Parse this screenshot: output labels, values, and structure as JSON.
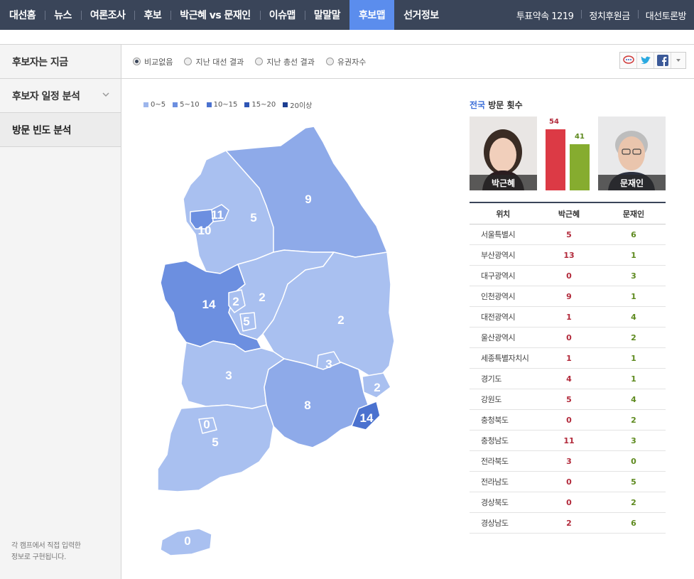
{
  "nav": {
    "left": [
      "대선홈",
      "뉴스",
      "여론조사",
      "후보",
      "박근혜 vs 문재인",
      "이슈맵",
      "말말말",
      "후보맵",
      "선거정보"
    ],
    "active_index": 7,
    "right": [
      "투표약속 1219",
      "정치후원금",
      "대선토론방"
    ]
  },
  "sidebar": {
    "items": [
      "후보자는 지금",
      "후보자 일정 분석",
      "방문 빈도 분석"
    ],
    "note_line1": "각 캠프에서 직접 입력한",
    "note_line2": "정보로 구현됩니다."
  },
  "filters": [
    "비교없음",
    "지난 대선 결과",
    "지난 총선 결과",
    "유권자수"
  ],
  "legend": [
    {
      "label": "0~5",
      "color": "#9db6ec"
    },
    {
      "label": "5~10",
      "color": "#6c8fe0"
    },
    {
      "label": "10~15",
      "color": "#4b72cf"
    },
    {
      "label": "15~20",
      "color": "#2f56b5"
    },
    {
      "label": "20이상",
      "color": "#1d3f92"
    }
  ],
  "map_labels": [
    "9",
    "11",
    "10",
    "5",
    "14",
    "2",
    "2",
    "5",
    "2",
    "3",
    "3",
    "8",
    "2",
    "14",
    "0",
    "5",
    "0"
  ],
  "panel": {
    "title_region": "전국",
    "title_rest": " 방문 횟수",
    "park": {
      "name": "박근혜",
      "total": "54",
      "value": 54,
      "color": "#dc3a45"
    },
    "moon": {
      "name": "문재인",
      "total": "41",
      "value": 41,
      "color": "#86ac2f"
    }
  },
  "table": {
    "headers": [
      "위치",
      "박근혜",
      "문재인"
    ],
    "rows": [
      [
        "서울특별시",
        "5",
        "6"
      ],
      [
        "부산광역시",
        "13",
        "1"
      ],
      [
        "대구광역시",
        "0",
        "3"
      ],
      [
        "인천광역시",
        "9",
        "1"
      ],
      [
        "대전광역시",
        "1",
        "4"
      ],
      [
        "울산광역시",
        "0",
        "2"
      ],
      [
        "세종특별자치시",
        "1",
        "1"
      ],
      [
        "경기도",
        "4",
        "1"
      ],
      [
        "강원도",
        "5",
        "4"
      ],
      [
        "충청북도",
        "0",
        "2"
      ],
      [
        "충청남도",
        "11",
        "3"
      ],
      [
        "전라북도",
        "3",
        "0"
      ],
      [
        "전라남도",
        "0",
        "5"
      ],
      [
        "경상북도",
        "0",
        "2"
      ],
      [
        "경상남도",
        "2",
        "6"
      ]
    ]
  }
}
